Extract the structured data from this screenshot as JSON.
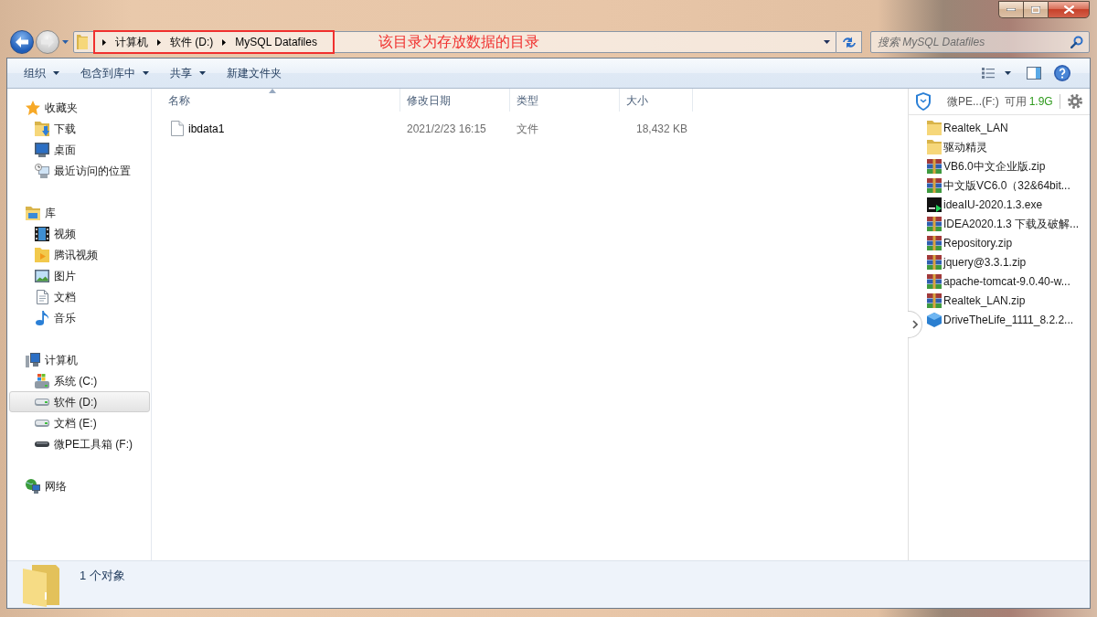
{
  "navigation": {
    "back": {
      "disabled": false
    },
    "forward": {
      "disabled": true
    }
  },
  "address_bar": {
    "breadcrumb": [
      "计算机",
      "软件 (D:)",
      "MySQL Datafiles"
    ]
  },
  "annotation": {
    "text": "该目录为存放数据的目录",
    "outline_breadcrumb": true
  },
  "search": {
    "placeholder": "搜索 MySQL Datafiles"
  },
  "toolbar": {
    "items": [
      {
        "label": "组织",
        "dropdown": true
      },
      {
        "label": "包含到库中",
        "dropdown": true
      },
      {
        "label": "共享",
        "dropdown": true
      },
      {
        "label": "新建文件夹",
        "dropdown": false
      }
    ]
  },
  "sidebar": {
    "groups": [
      {
        "label": "收藏夹",
        "kind": "favorites",
        "selected": false,
        "children": [
          {
            "label": "下载",
            "kind": "downloads",
            "selected": false
          },
          {
            "label": "桌面",
            "kind": "desktop",
            "selected": false
          },
          {
            "label": "最近访问的位置",
            "kind": "recent",
            "selected": false
          }
        ]
      },
      {
        "label": "库",
        "kind": "library",
        "selected": false,
        "children": [
          {
            "label": "视频",
            "kind": "videos",
            "selected": false
          },
          {
            "label": "腾讯视频",
            "kind": "player",
            "selected": false
          },
          {
            "label": "图片",
            "kind": "pictures",
            "selected": false
          },
          {
            "label": "文档",
            "kind": "documents",
            "selected": false
          },
          {
            "label": "音乐",
            "kind": "music",
            "selected": false
          }
        ]
      },
      {
        "label": "计算机",
        "kind": "computer",
        "selected": false,
        "children": [
          {
            "label": "系统 (C:)",
            "kind": "sysdrive",
            "selected": false
          },
          {
            "label": "软件 (D:)",
            "kind": "drive",
            "selected": true
          },
          {
            "label": "文档 (E:)",
            "kind": "drive",
            "selected": false
          },
          {
            "label": "微PE工具箱 (F:)",
            "kind": "removable",
            "selected": false
          }
        ]
      },
      {
        "label": "网络",
        "kind": "network",
        "selected": false
      }
    ]
  },
  "table": {
    "columns": [
      {
        "label": "名称",
        "sorted": true
      },
      {
        "label": "修改日期",
        "sorted": false
      },
      {
        "label": "类型",
        "sorted": false
      },
      {
        "label": "大小",
        "sorted": false
      }
    ],
    "rows": [
      {
        "cells": [
          "ibdata1",
          "2021/2/23 16:15",
          "文件",
          "18,432 KB"
        ],
        "selected": false
      }
    ]
  },
  "side_panel": {
    "drive": "微PE...(F:)",
    "free_label": "可用",
    "free_value": "1.9G",
    "items": [
      {
        "name": "Realtek_LAN",
        "kind": "folder"
      },
      {
        "name": "驱动精灵",
        "kind": "folder"
      },
      {
        "name": "VB6.0中文企业版.zip",
        "kind": "archive"
      },
      {
        "name": "中文版VC6.0（32&64bit...",
        "kind": "archive"
      },
      {
        "name": "ideaIU-2020.1.3.exe",
        "kind": "program"
      },
      {
        "name": "IDEA2020.1.3 下载及破解...",
        "kind": "archive"
      },
      {
        "name": "Repository.zip",
        "kind": "archive"
      },
      {
        "name": "jquery@3.3.1.zip",
        "kind": "archive"
      },
      {
        "name": "apache-tomcat-9.0.40-w...",
        "kind": "archive"
      },
      {
        "name": "Realtek_LAN.zip",
        "kind": "archive"
      },
      {
        "name": "DriveTheLife_1111_8.2.2...",
        "kind": "installer"
      }
    ]
  },
  "status_bar": {
    "text": "1 个对象"
  }
}
